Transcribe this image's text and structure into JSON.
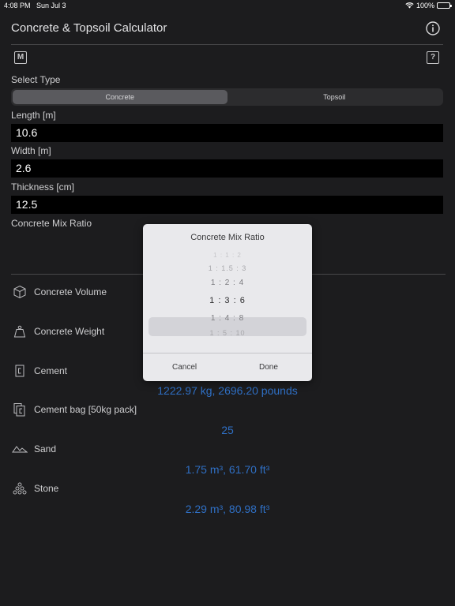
{
  "status_bar": {
    "time": "4:08 PM",
    "date": "Sun Jul 3",
    "battery": "100%"
  },
  "header": {
    "title": "Concrete & Topsoil Calculator",
    "info_icon": "info-circle-icon"
  },
  "toolbar": {
    "m_label": "M",
    "help_label": "?"
  },
  "type_selector": {
    "label": "Select Type",
    "options": [
      "Concrete",
      "Topsoil"
    ],
    "selected": "Concrete"
  },
  "inputs": {
    "length": {
      "label": "Length [m]",
      "value": "10.6"
    },
    "width": {
      "label": "Width [m]",
      "value": "2.6"
    },
    "thickness": {
      "label": "Thickness [cm]",
      "value": "12.5"
    },
    "mix_ratio": {
      "label": "Concrete Mix Ratio"
    }
  },
  "results": [
    {
      "label": "Concrete Volume",
      "icon": "cube-icon",
      "value": ""
    },
    {
      "label": "Concrete Weight",
      "icon": "weight-icon",
      "value": ""
    },
    {
      "label": "Cement",
      "icon": "cement-icon",
      "value": "1222.97 kg, 2696.20 pounds"
    },
    {
      "label": "Cement bag [50kg pack]",
      "icon": "cement-bag-icon",
      "value": "25"
    },
    {
      "label": "Sand",
      "icon": "sand-icon",
      "value": "1.75 m³, 61.70 ft³"
    },
    {
      "label": "Stone",
      "icon": "stone-icon",
      "value": "2.29 m³, 80.98 ft³"
    }
  ],
  "modal": {
    "title": "Concrete Mix Ratio",
    "options": [
      "1 : 1 : 2",
      "1 : 1.5 : 3",
      "1 : 2 : 4",
      "1 : 3 : 6",
      "1 : 4 : 8",
      "1 : 5 : 10"
    ],
    "selected": "1 : 3 : 6",
    "cancel_label": "Cancel",
    "done_label": "Done"
  }
}
